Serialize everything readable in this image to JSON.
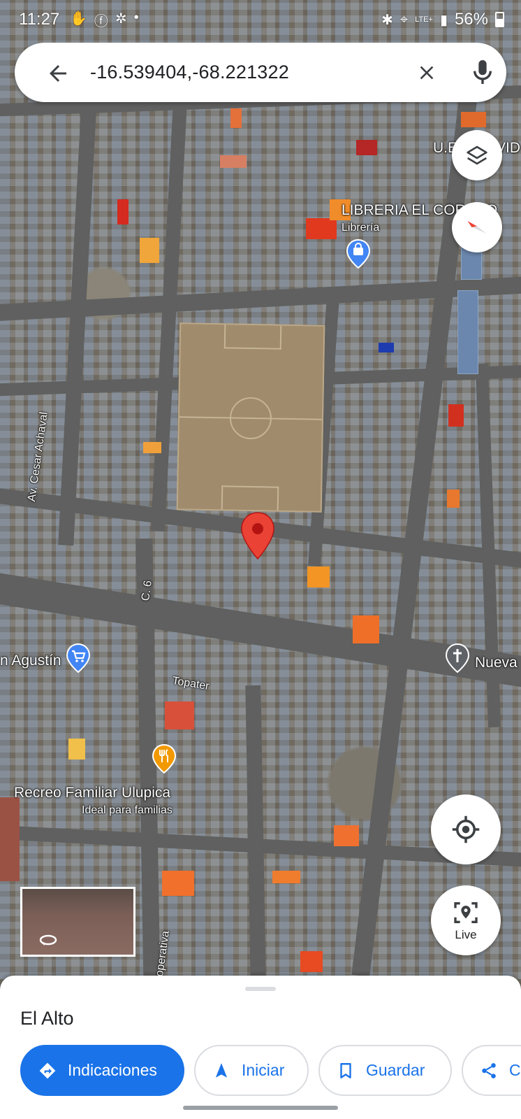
{
  "status_bar": {
    "time": "11:27",
    "network": "LTE+",
    "battery": "56%"
  },
  "search": {
    "query": "-16.539404,-68.221322"
  },
  "map": {
    "labels": {
      "school_partial": "U.E",
      "school_partial_right": "VID",
      "bookstore_name": "LIBRERIA EL COR",
      "bookstore_name_tail": "O",
      "bookstore_category": "Librería",
      "street_cesar": "Av. Cesar Achaval",
      "street_c6": "C. 6",
      "store_agustin": "n Agustín",
      "church_nueva": "Nueva",
      "street_topater": "Topater",
      "restaurant_name": "Recreo Familiar Ulupica",
      "restaurant_tagline": "Ideal para familias",
      "street_cooperativa": "operativa"
    }
  },
  "controls": {
    "live_label": "Live"
  },
  "sheet": {
    "place_title": "El Alto",
    "actions": {
      "directions": "Indicaciones",
      "start": "Iniciar",
      "save": "Guardar",
      "share": "Co"
    }
  },
  "colors": {
    "accent": "#1a73e8",
    "pin_red": "#ea4335",
    "shopping_blue": "#4285f4",
    "food_orange": "#f29900",
    "place_gray": "#5f6368"
  },
  "icons": {
    "back": "arrow-left-icon",
    "clear": "close-icon",
    "mic": "microphone-icon",
    "layers": "layers-icon",
    "compass": "compass-icon",
    "locate": "my-location-icon",
    "live": "live-view-icon",
    "directions": "directions-icon",
    "start": "navigation-arrow-icon",
    "save": "bookmark-icon",
    "share": "share-icon"
  }
}
